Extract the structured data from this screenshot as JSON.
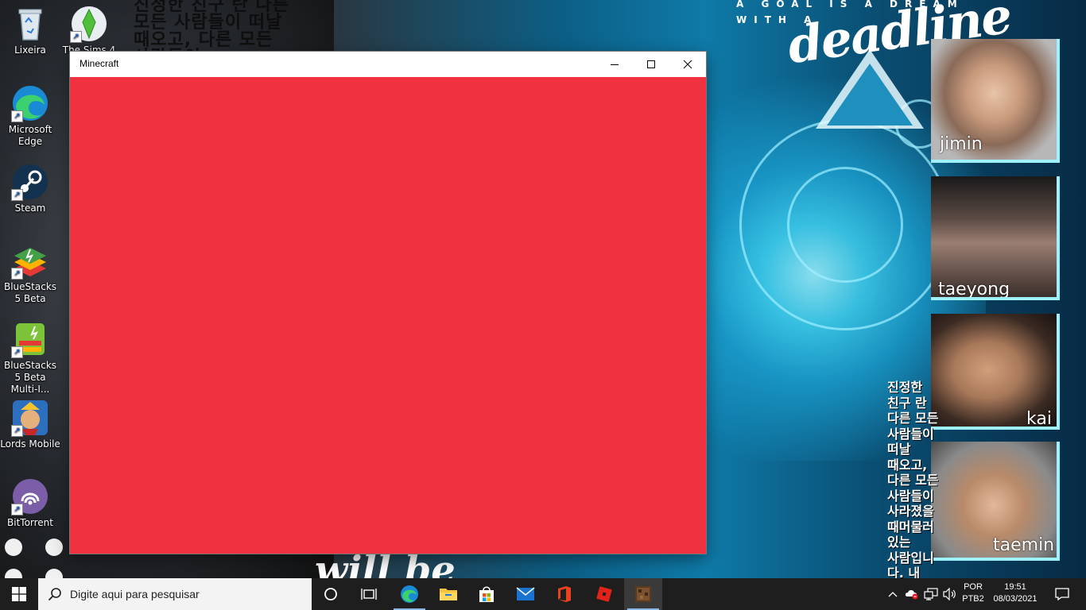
{
  "wallpaper": {
    "korean_top": "진정한 친구 란 다른\n모든 사람들이 떠날\n때오고, 다른 모든\n사람들이",
    "goal_line": "A GOAL IS A DREAM",
    "with_line": "WITH A",
    "deadline": "deadline",
    "photos": [
      {
        "name": "jimin"
      },
      {
        "name": "taeyong"
      },
      {
        "name": "kai"
      },
      {
        "name": "taemin"
      }
    ],
    "korean_right": "진정한\n친구 란\n다른 모든\n사람들이\n떠날\n때오고,\n다른 모든\n사람들이\n사라졌을\n때머물러\n있는\n사람입니\n다. 내\n친구가",
    "bottom_text": "will be"
  },
  "desktop_icons": [
    {
      "label": "Lixeira",
      "icon": "recycle-bin-icon"
    },
    {
      "label": "The Sims 4",
      "icon": "the-sims-4-icon"
    },
    {
      "label": "Microsoft Edge",
      "icon": "edge-icon"
    },
    {
      "label": "Steam",
      "icon": "steam-icon"
    },
    {
      "label": "BlueStacks 5 Beta",
      "icon": "bluestacks-icon"
    },
    {
      "label": "BlueStacks 5 Beta Multi-I...",
      "icon": "bluestacks-multi-icon"
    },
    {
      "label": "Lords Mobile",
      "icon": "lords-mobile-icon"
    },
    {
      "label": "BitTorrent",
      "icon": "bittorrent-icon"
    }
  ],
  "window": {
    "title": "Minecraft",
    "client_color": "#f0313f"
  },
  "taskbar": {
    "search_placeholder": "Digite aqui para pesquisar",
    "apps": [
      "cortana-icon",
      "task-view-icon",
      "edge-icon",
      "file-explorer-icon",
      "store-icon",
      "mail-icon",
      "office-icon",
      "roblox-icon",
      "minecraft-icon"
    ],
    "lang_top": "POR",
    "lang_bottom": "PTB2",
    "time": "19:51",
    "date": "08/03/2021"
  }
}
